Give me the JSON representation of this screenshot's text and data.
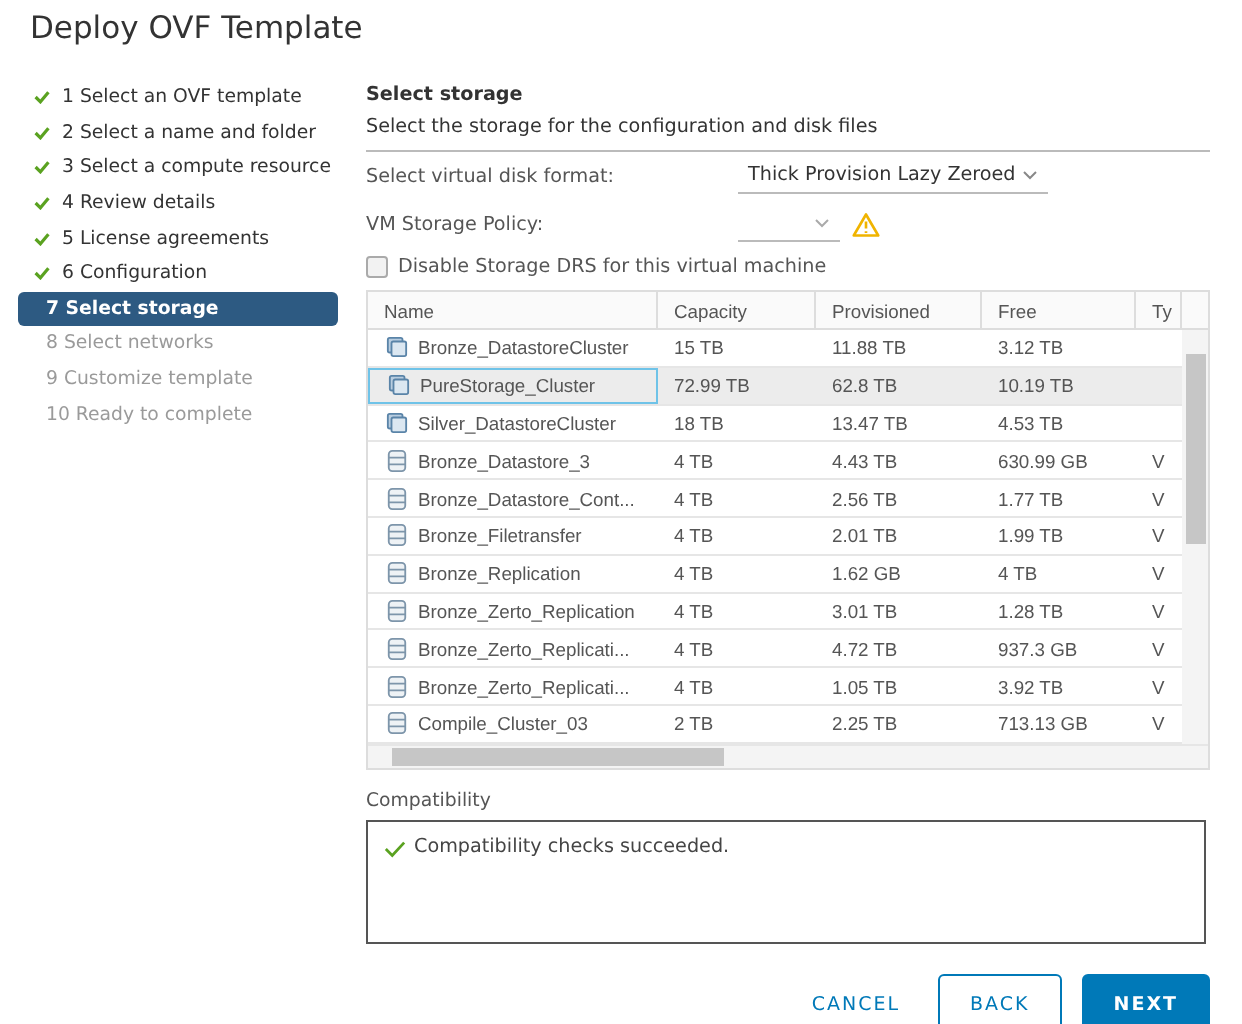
{
  "window": {
    "title": "Deploy OVF Template"
  },
  "steps": [
    {
      "label": "1 Select an OVF template",
      "kind": "done",
      "selected": false
    },
    {
      "label": "2 Select a name and folder",
      "kind": "done",
      "selected": false
    },
    {
      "label": "3 Select a compute resource",
      "kind": "done",
      "selected": false
    },
    {
      "label": "4 Review details",
      "kind": "done",
      "selected": false
    },
    {
      "label": "5 License agreements",
      "kind": "done",
      "selected": false
    },
    {
      "label": "6 Configuration",
      "kind": "done",
      "selected": false
    },
    {
      "label": "7 Select storage",
      "kind": "current",
      "selected": true
    },
    {
      "label": "8 Select networks",
      "kind": "pending",
      "selected": false
    },
    {
      "label": "9 Customize template",
      "kind": "pending",
      "selected": false
    },
    {
      "label": "10 Ready to complete",
      "kind": "pending",
      "selected": false
    }
  ],
  "section": {
    "title": "Select storage",
    "subtitle": "Select the storage for the configuration and disk files"
  },
  "disk_format": {
    "label": "Select virtual disk format:",
    "value": "Thick Provision Lazy Zeroed"
  },
  "storage_policy": {
    "label": "VM Storage Policy:",
    "warning": true
  },
  "disable_drs": {
    "label": "Disable Storage DRS for this virtual machine",
    "checked": false
  },
  "table": {
    "columns": [
      "Name",
      "Capacity",
      "Provisioned",
      "Free",
      "Ty"
    ],
    "rows": [
      {
        "kind": "cluster",
        "selected": false,
        "cells": [
          "Bronze_DatastoreCluster",
          "15 TB",
          "11.88 TB",
          "3.12 TB"
        ]
      },
      {
        "kind": "cluster",
        "selected": true,
        "cells": [
          "PureStorage_Cluster",
          "72.99 TB",
          "62.8 TB",
          "10.19 TB"
        ]
      },
      {
        "kind": "cluster",
        "selected": false,
        "cells": [
          "Silver_DatastoreCluster",
          "18 TB",
          "13.47 TB",
          "4.53 TB"
        ]
      },
      {
        "kind": "datastore",
        "selected": false,
        "cells": [
          "Bronze_Datastore_3",
          "4 TB",
          "4.43 TB",
          "630.99 GB",
          "V"
        ]
      },
      {
        "kind": "datastore",
        "selected": false,
        "cells": [
          "Bronze_Datastore_Cont...",
          "4 TB",
          "2.56 TB",
          "1.77 TB",
          "V"
        ]
      },
      {
        "kind": "datastore",
        "selected": false,
        "cells": [
          "Bronze_Filetransfer",
          "4 TB",
          "2.01 TB",
          "1.99 TB",
          "V"
        ]
      },
      {
        "kind": "datastore",
        "selected": false,
        "cells": [
          "Bronze_Replication",
          "4 TB",
          "1.62 GB",
          "4 TB",
          "V"
        ]
      },
      {
        "kind": "datastore",
        "selected": false,
        "cells": [
          "Bronze_Zerto_Replication",
          "4 TB",
          "3.01 TB",
          "1.28 TB",
          "V"
        ]
      },
      {
        "kind": "datastore",
        "selected": false,
        "cells": [
          "Bronze_Zerto_Replicati...",
          "4 TB",
          "4.72 TB",
          "937.3 GB",
          "V"
        ]
      },
      {
        "kind": "datastore",
        "selected": false,
        "cells": [
          "Bronze_Zerto_Replicati...",
          "4 TB",
          "1.05 TB",
          "3.92 TB",
          "V"
        ]
      },
      {
        "kind": "datastore",
        "selected": false,
        "cells": [
          "Compile_Cluster_03",
          "2 TB",
          "2.25 TB",
          "713.13 GB",
          "V"
        ]
      }
    ]
  },
  "compatibility": {
    "label": "Compatibility",
    "message": "Compatibility checks succeeded."
  },
  "buttons": [
    {
      "label": "CANCEL",
      "kind": "flat"
    },
    {
      "label": "BACK",
      "kind": "outline"
    },
    {
      "label": "NEXT",
      "kind": "primary"
    }
  ]
}
